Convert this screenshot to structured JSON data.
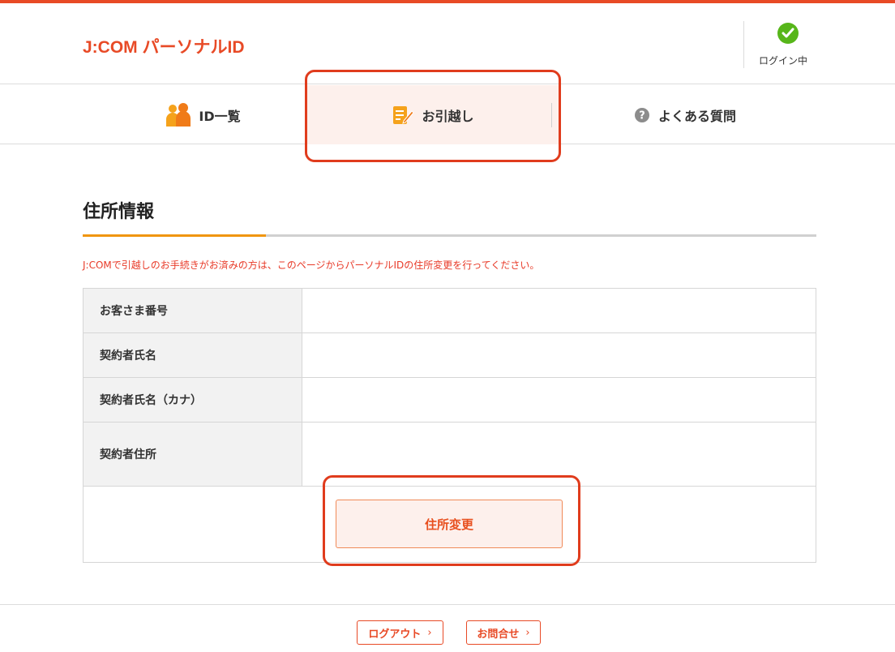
{
  "header": {
    "logo": "J:COM パーソナルID",
    "login_status": "ログイン中"
  },
  "nav": {
    "items": [
      {
        "label": "ID一覧",
        "icon": "users-icon"
      },
      {
        "label": "お引越し",
        "icon": "edit-document-icon",
        "active": true
      },
      {
        "label": "よくある質問",
        "icon": "question-circle-icon"
      }
    ]
  },
  "main": {
    "title": "住所情報",
    "notice": "J:COMで引越しのお手続きがお済みの方は、このページからパーソナルIDの住所変更を行ってください。",
    "rows": [
      {
        "label": "お客さま番号",
        "value": ""
      },
      {
        "label": "契約者氏名",
        "value": ""
      },
      {
        "label": "契約者氏名（カナ）",
        "value": ""
      },
      {
        "label": "契約者住所",
        "value": ""
      }
    ],
    "change_button": "住所変更"
  },
  "footer": {
    "logout": "ログアウト",
    "contact": "お問合せ",
    "chevron": "›"
  },
  "colors": {
    "brand": "#e84a26",
    "accent_underline": "#f0960e",
    "login_ok": "#57b61a",
    "highlight": "#e03c1d"
  }
}
